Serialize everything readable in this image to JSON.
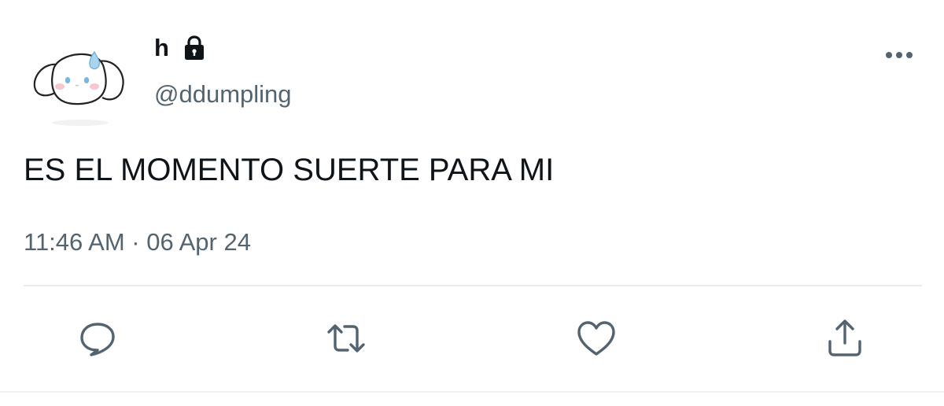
{
  "user": {
    "display_name": "h",
    "handle": "@ddumpling"
  },
  "tweet": {
    "text": "ES EL MOMENTO SUERTE PARA MI",
    "timestamp": "11:46 AM · 06 Apr 24"
  },
  "icons": {
    "lock": "lock-icon",
    "more": "more-horizontal-icon",
    "reply": "reply-icon",
    "retweet": "retweet-icon",
    "like": "heart-icon",
    "share": "share-icon"
  },
  "colors": {
    "text_primary": "#0f1419",
    "text_secondary": "#536471",
    "icon": "#536471",
    "divider": "#e6ecf0"
  }
}
